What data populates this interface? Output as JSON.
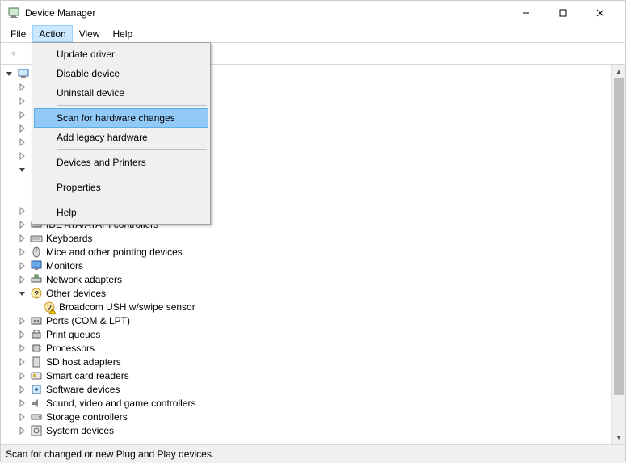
{
  "window": {
    "title": "Device Manager"
  },
  "menubar": {
    "items": [
      "File",
      "Action",
      "View",
      "Help"
    ],
    "open_index": 1
  },
  "dropdown": {
    "groups": [
      [
        "Update driver",
        "Disable device",
        "Uninstall device"
      ],
      [
        "Scan for hardware changes",
        "Add legacy hardware"
      ],
      [
        "Devices and Printers"
      ],
      [
        "Properties"
      ],
      [
        "Help"
      ]
    ],
    "highlight": "Scan for hardware changes"
  },
  "tree": {
    "root": {
      "label": "",
      "expanded": true
    },
    "nodes": [
      {
        "label": "",
        "level": 1,
        "expanded": false,
        "icon": "generic"
      },
      {
        "label": "",
        "level": 1,
        "expanded": false,
        "icon": "generic"
      },
      {
        "label": "",
        "level": 1,
        "expanded": false,
        "icon": "generic"
      },
      {
        "label": "",
        "level": 1,
        "expanded": false,
        "icon": "generic"
      },
      {
        "label": "",
        "level": 1,
        "expanded": false,
        "icon": "generic"
      },
      {
        "label": "",
        "level": 1,
        "expanded": false,
        "icon": "generic"
      },
      {
        "label": "",
        "level": 1,
        "expanded": true,
        "icon": "generic"
      },
      {
        "label": "",
        "level": 2,
        "expanded": null,
        "icon": "generic"
      },
      {
        "label": "",
        "level": 2,
        "expanded": null,
        "icon": "generic"
      },
      {
        "label": "",
        "level": 1,
        "expanded": false,
        "icon": "generic"
      },
      {
        "label": "IDE ATA/ATAPI controllers",
        "level": 1,
        "expanded": false,
        "icon": "ide"
      },
      {
        "label": "Keyboards",
        "level": 1,
        "expanded": false,
        "icon": "keyboard"
      },
      {
        "label": "Mice and other pointing devices",
        "level": 1,
        "expanded": false,
        "icon": "mouse"
      },
      {
        "label": "Monitors",
        "level": 1,
        "expanded": false,
        "icon": "monitor"
      },
      {
        "label": "Network adapters",
        "level": 1,
        "expanded": false,
        "icon": "network"
      },
      {
        "label": "Other devices",
        "level": 1,
        "expanded": true,
        "icon": "other"
      },
      {
        "label": "Broadcom USH w/swipe sensor",
        "level": 2,
        "expanded": null,
        "icon": "warning"
      },
      {
        "label": "Ports (COM & LPT)",
        "level": 1,
        "expanded": false,
        "icon": "port"
      },
      {
        "label": "Print queues",
        "level": 1,
        "expanded": false,
        "icon": "printer"
      },
      {
        "label": "Processors",
        "level": 1,
        "expanded": false,
        "icon": "cpu"
      },
      {
        "label": "SD host adapters",
        "level": 1,
        "expanded": false,
        "icon": "sd"
      },
      {
        "label": "Smart card readers",
        "level": 1,
        "expanded": false,
        "icon": "smartcard"
      },
      {
        "label": "Software devices",
        "level": 1,
        "expanded": false,
        "icon": "software"
      },
      {
        "label": "Sound, video and game controllers",
        "level": 1,
        "expanded": false,
        "icon": "sound"
      },
      {
        "label": "Storage controllers",
        "level": 1,
        "expanded": false,
        "icon": "storage"
      },
      {
        "label": "System devices",
        "level": 1,
        "expanded": false,
        "icon": "system"
      }
    ]
  },
  "statusbar": {
    "text": "Scan for changed or new Plug and Play devices."
  }
}
